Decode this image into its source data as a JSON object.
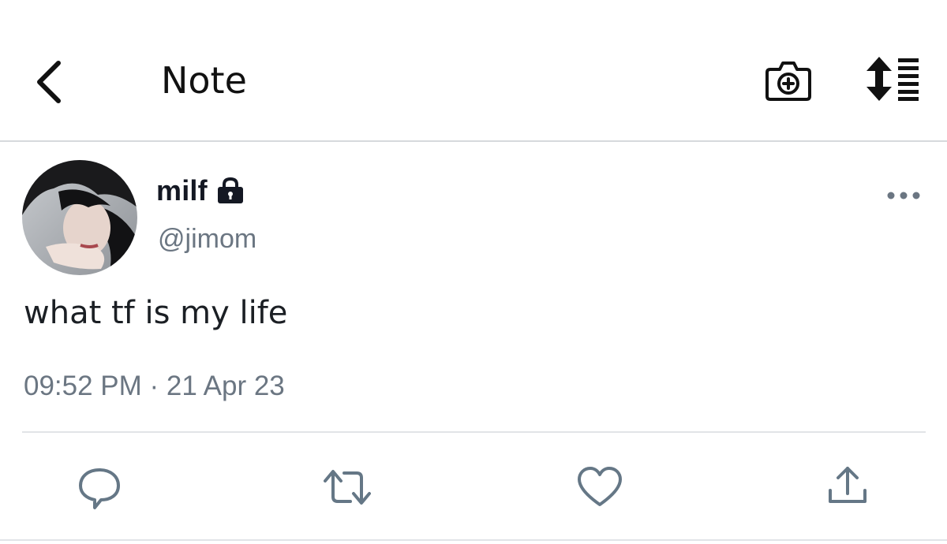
{
  "header": {
    "title": "Note",
    "back_icon": "chevron-left-icon",
    "camera_icon": "camera-plus-icon",
    "sort_icon": "sort-list-icon"
  },
  "tweet": {
    "display_name": "milf",
    "protected_icon": "lock-icon",
    "handle": "@jimom",
    "text": "what tf is my life",
    "timestamp": "09:52 PM · 21 Apr 23",
    "more_icon": "more-horizontal-icon"
  },
  "actions": [
    {
      "name": "reply",
      "icon": "reply-icon"
    },
    {
      "name": "retweet",
      "icon": "retweet-icon"
    },
    {
      "name": "like",
      "icon": "heart-icon"
    },
    {
      "name": "share",
      "icon": "share-icon"
    }
  ],
  "colors": {
    "primary_text": "#141823",
    "secondary_text": "#6b7682",
    "divider": "#e1e4e7",
    "icon": "#657786"
  }
}
